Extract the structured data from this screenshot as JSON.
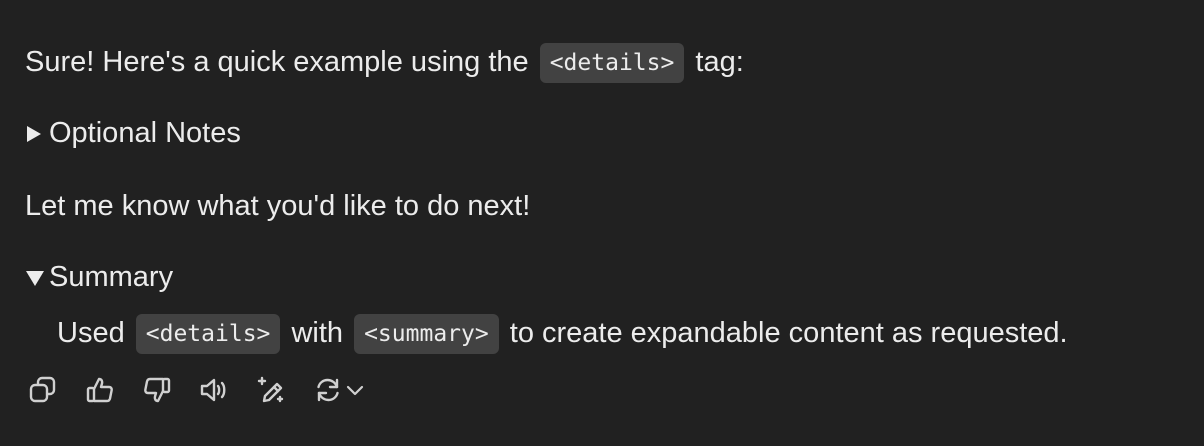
{
  "message": {
    "intro": {
      "before": "Sure! Here's a quick example using the ",
      "code": "<details>",
      "after": " tag:"
    },
    "details_collapsed": {
      "marker": "collapsed-triangle-icon",
      "summary": "Optional Notes"
    },
    "outro": "Let me know what you'd like to do next!",
    "details_expanded": {
      "marker": "expanded-triangle-icon",
      "summary": "Summary",
      "body": {
        "part1": "Used ",
        "code1": "<details>",
        "part2": " with ",
        "code2": "<summary>",
        "part3": " to create expandable content as requested."
      }
    }
  },
  "actions": [
    {
      "name": "copy-icon"
    },
    {
      "name": "thumbs-up-icon"
    },
    {
      "name": "thumbs-down-icon"
    },
    {
      "name": "read-aloud-icon"
    },
    {
      "name": "edit-sparkle-icon"
    },
    {
      "name": "regenerate-icon"
    },
    {
      "name": "chevron-down-icon"
    }
  ],
  "colors": {
    "background": "#212121",
    "text": "#ececec",
    "code_background": "#424242",
    "icon": "#d0d0d0"
  }
}
